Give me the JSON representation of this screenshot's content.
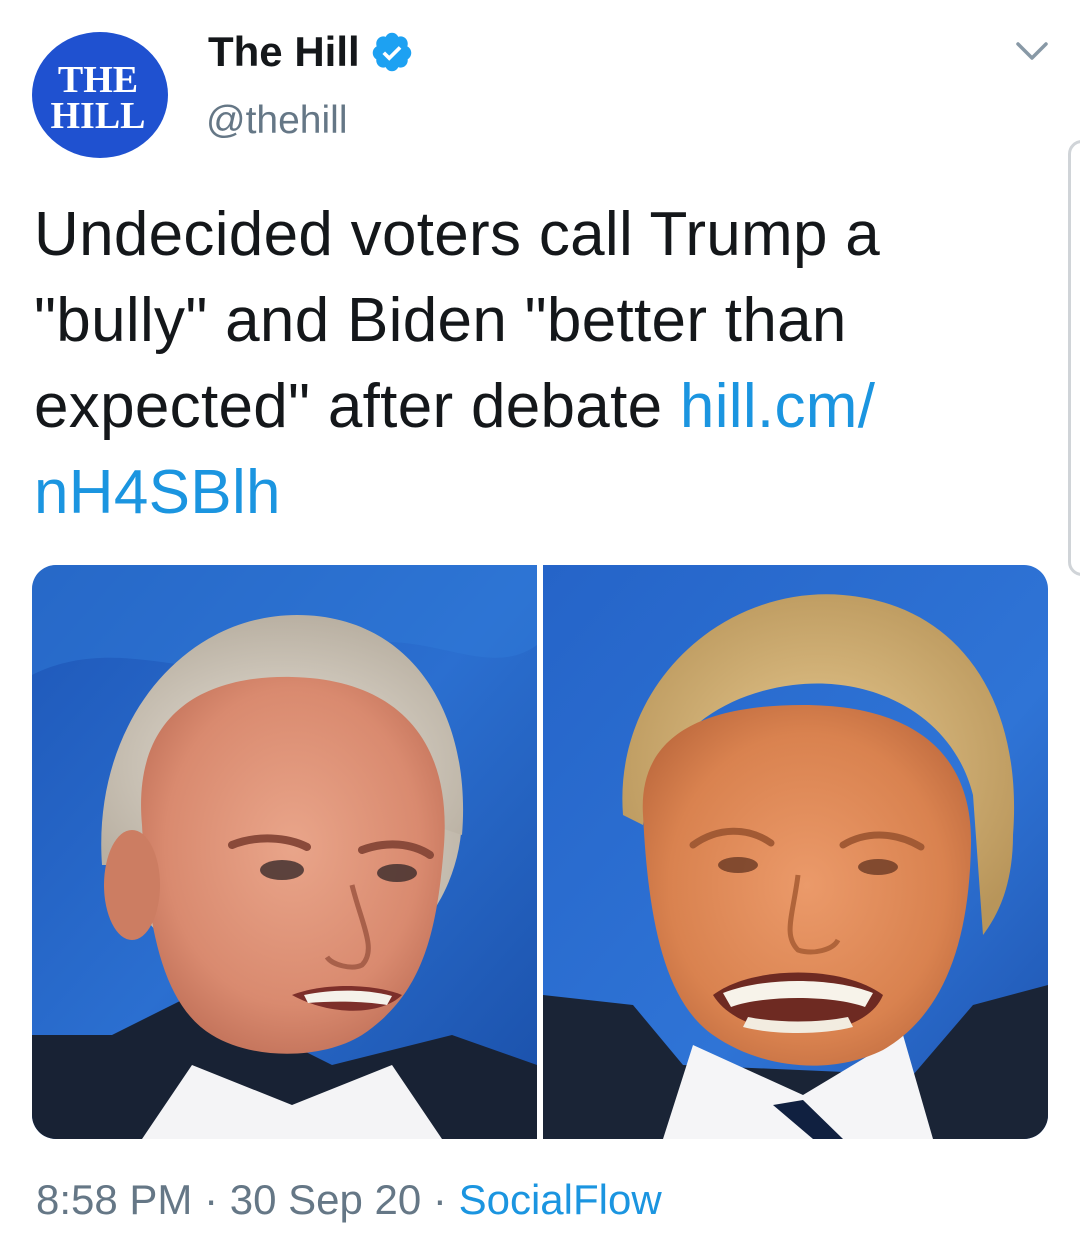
{
  "account": {
    "display_name": "The Hill",
    "handle": "@thehill",
    "avatar_text_line1": "THE",
    "avatar_text_line2": "HILL",
    "verified": true
  },
  "tweet": {
    "text": "Undecided voters call Trump a \"bully\" and Biden \"better than expected\" after debate ",
    "link_text": "hill.cm/\nnH4SBlh"
  },
  "media": {
    "images": [
      "photo-left",
      "photo-right"
    ]
  },
  "meta": {
    "time": "8:58 PM",
    "separator": " · ",
    "date": "30 Sep 20",
    "source": "SocialFlow"
  },
  "icons": {
    "verified": "verified-badge-icon",
    "menu": "chevron-down-icon"
  },
  "colors": {
    "link": "#1b95e0",
    "secondary_text": "#657786",
    "avatar_bg": "#1f51d0",
    "verified": "#1da1f2"
  }
}
